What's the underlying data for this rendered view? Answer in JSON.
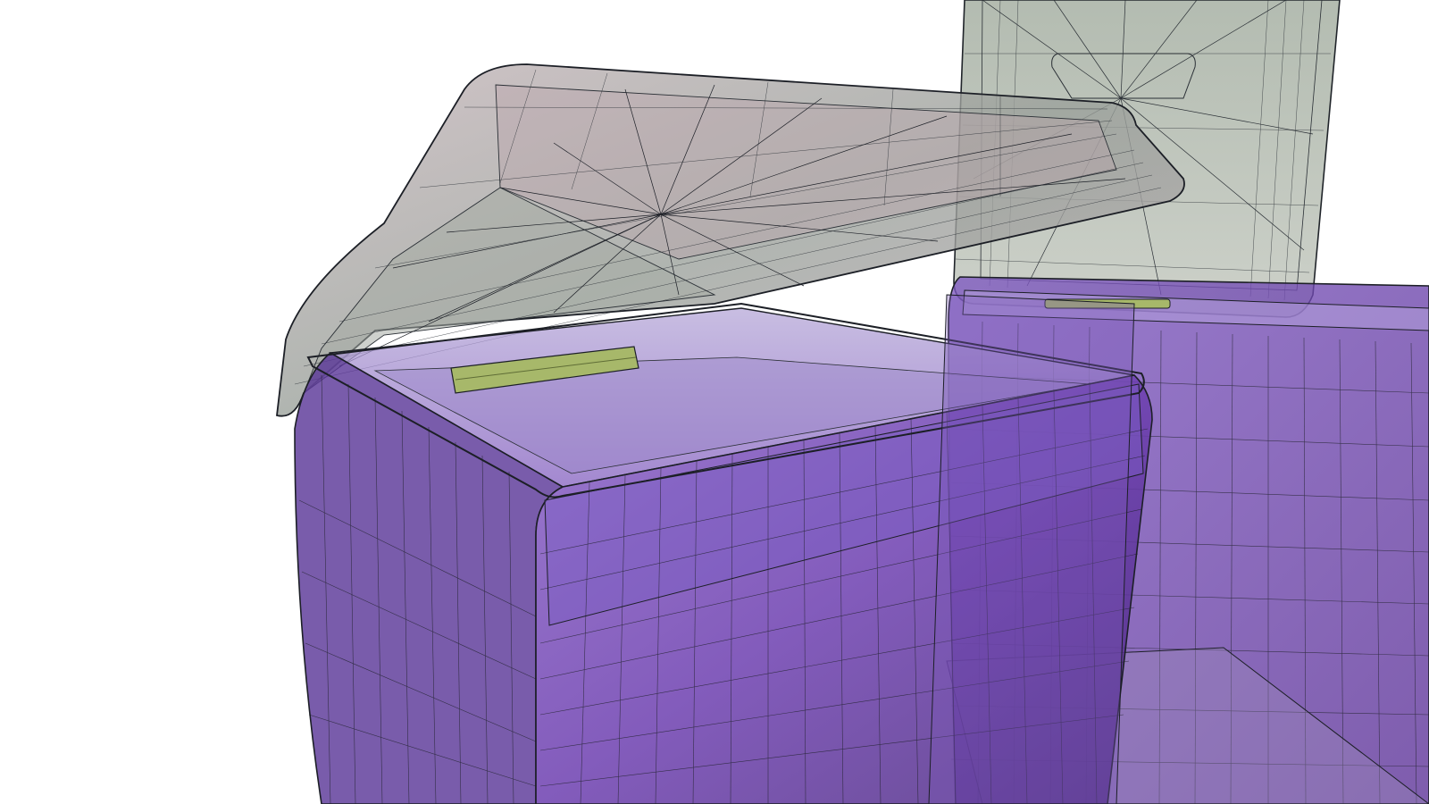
{
  "scene": {
    "background_color": "#ffffff",
    "render_style": "wireframe-over-translucent-shaded",
    "wire_color": "#1c1f26",
    "objects": [
      {
        "name": "front-container-body",
        "color": "#6a3aa8",
        "opacity": 0.78
      },
      {
        "name": "front-container-lid-open",
        "color": "#8e9890",
        "opacity": 0.75
      },
      {
        "name": "front-container-hinge-clip",
        "color": "#a7b86a",
        "opacity": 0.95
      },
      {
        "name": "rear-container-body",
        "color": "#7a48b8",
        "opacity": 0.7
      },
      {
        "name": "rear-container-lid-upright",
        "color": "#a7b3a2",
        "opacity": 0.78
      },
      {
        "name": "rear-container-hinge-clip",
        "color": "#a7b86a",
        "opacity": 0.95
      }
    ]
  }
}
